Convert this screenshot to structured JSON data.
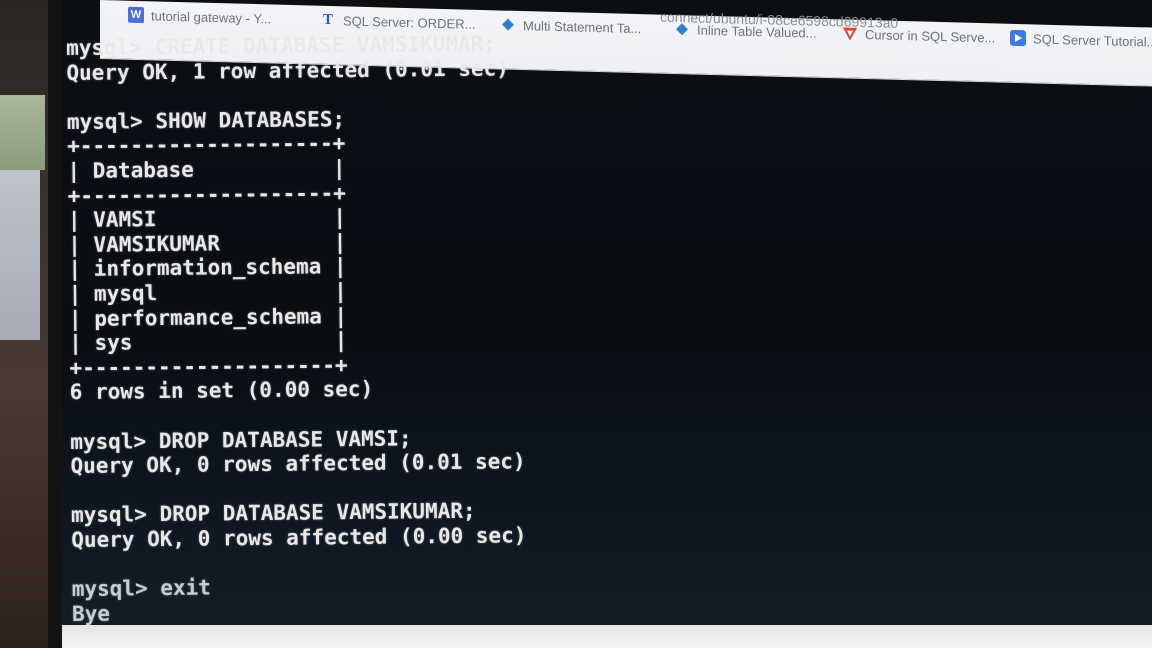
{
  "browser": {
    "url_fragment": "connect/ubuntu/i-08ce6598cd69913a0",
    "bookmarks": [
      {
        "label": "tutorial gateway - Y...",
        "icon": "w-logo-icon",
        "color": "#4a6fd6"
      },
      {
        "label": "SQL Server: ORDER...",
        "icon": "t-logo-icon",
        "color": "#2b5cb8"
      },
      {
        "label": "Multi Statement Ta...",
        "icon": "diamond-icon",
        "color": "#2f7fd0"
      },
      {
        "label": "Inline Table Valued...",
        "icon": "diamond-icon",
        "color": "#2f7fd0"
      },
      {
        "label": "Cursor in SQL Serve...",
        "icon": "v-logo-icon",
        "color": "#e0443a"
      },
      {
        "label": "SQL Server Tutorial...",
        "icon": "play-icon",
        "color": "#3d7be0"
      }
    ]
  },
  "terminal": {
    "lines": [
      "mysql> CREATE DATABASE VAMSIKUMAR;",
      "Query OK, 1 row affected (0.01 sec)",
      "",
      "mysql> SHOW DATABASES;",
      "+--------------------+",
      "| Database           |",
      "+--------------------+",
      "| VAMSI              |",
      "| VAMSIKUMAR         |",
      "| information_schema |",
      "| mysql              |",
      "| performance_schema |",
      "| sys                |",
      "+--------------------+",
      "6 rows in set (0.00 sec)",
      "",
      "mysql> DROP DATABASE VAMSI;",
      "Query OK, 0 rows affected (0.01 sec)",
      "",
      "mysql> DROP DATABASE VAMSIKUMAR;",
      "Query OK, 0 rows affected (0.00 sec)",
      "",
      "mysql> exit",
      "Bye"
    ]
  }
}
